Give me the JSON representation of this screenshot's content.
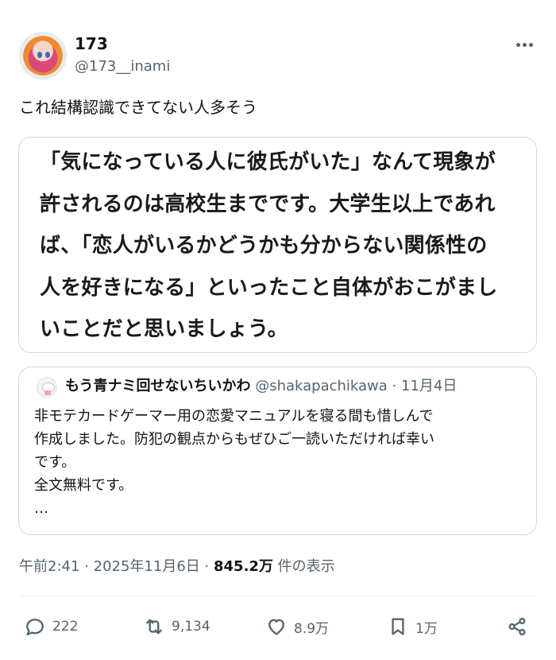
{
  "author": {
    "display_name": "173",
    "handle": "@173__inami"
  },
  "tweet": {
    "text": "これ結構認識できてない人多そう"
  },
  "image_text": {
    "lines": [
      "「気になっている人に彼氏がいた」なんて現象が",
      "許されるのは高校生までです。大学生以上であれ",
      "ば、「恋人がいるかどうかも分からない関係性の",
      "人を好きになる」といったこと自体がおこがまし",
      "いことだと思いましょう。"
    ]
  },
  "quote": {
    "name": "もう青ナミ回せないちいかわ",
    "handle": "@shakapachikawa",
    "separator": "·",
    "date": "11月4日",
    "lines": [
      "非モテカードゲーマー用の恋愛マニュアルを寝る間も惜しんで",
      "作成しました。防犯の観点からもぜひご一読いただければ幸い",
      "です。",
      "全文無料です。",
      "…"
    ]
  },
  "meta": {
    "time": "午前2:41",
    "sep1": "·",
    "date": "2025年11月6日",
    "sep2": "·",
    "views": "845.2万",
    "views_label": "件の表示"
  },
  "actions": {
    "replies": "222",
    "retweets": "9,134",
    "likes": "8.9万",
    "bookmarks": "1万"
  },
  "colors": {
    "text": "#0f1419",
    "secondary": "#536471",
    "border": "#cfd9de"
  }
}
